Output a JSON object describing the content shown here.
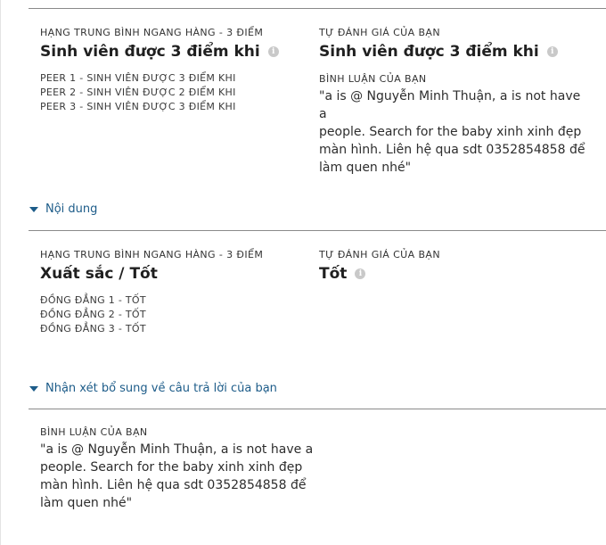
{
  "section1": {
    "left": {
      "heading": "HẠNG TRUNG BÌNH NGANG HÀNG - 3 ĐIỂM",
      "value": "Sinh viên được 3 điểm khi",
      "peers": [
        "PEER 1 - SINH VIÊN ĐƯỢC 3 ĐIỂM KHI",
        "PEER 2 - SINH VIÊN ĐƯỢC 2 ĐIỂM KHI",
        "PEER 3 - SINH VIÊN ĐƯỢC 3 ĐIỂM KHI"
      ]
    },
    "right": {
      "heading": "TỰ ĐÁNH GIÁ CỦA BẠN",
      "value": "Sinh viên được 3 điểm khi",
      "comment_label": "BÌNH LUẬN CỦA BẠN",
      "comment_lines": [
        "\"a is @ Nguyễn Minh Thuận, a is not have a",
        "people. Search for the baby xinh xinh đẹp",
        "màn hình. Liên hệ qua sdt 0352854858 để",
        "làm quen nhé\""
      ]
    }
  },
  "toggle1": {
    "label": "Nội dung"
  },
  "section2": {
    "left": {
      "heading": "HẠNG TRUNG BÌNH NGANG HÀNG - 3 ĐIỂM",
      "value": "Xuất sắc / Tốt",
      "peers": [
        "ĐỒNG ĐẲNG 1 - TỐT",
        "ĐỒNG ĐẲNG 2 - TỐT",
        "ĐỒNG ĐẲNG 3 - TỐT"
      ]
    },
    "right": {
      "heading": "TỰ ĐÁNH GIÁ CỦA BẠN",
      "value": "Tốt"
    }
  },
  "toggle2": {
    "label": "Nhận xét bổ sung về câu trả lời của bạn"
  },
  "section3": {
    "comment_label": "BÌNH LUẬN CỦA BẠN",
    "comment_lines": [
      "\"a is @ Nguyễn Minh Thuận, a is not have a",
      "people. Search for the baby xinh xinh đẹp",
      "màn hình. Liên hệ qua sdt 0352854858 để",
      "làm quen nhé\""
    ]
  },
  "icons": {
    "info": "info-icon",
    "caret": "caret-down-icon"
  },
  "colors": {
    "link": "#1d5c89",
    "divider": "#8a8a8a",
    "icon": "#c9c9c9"
  }
}
